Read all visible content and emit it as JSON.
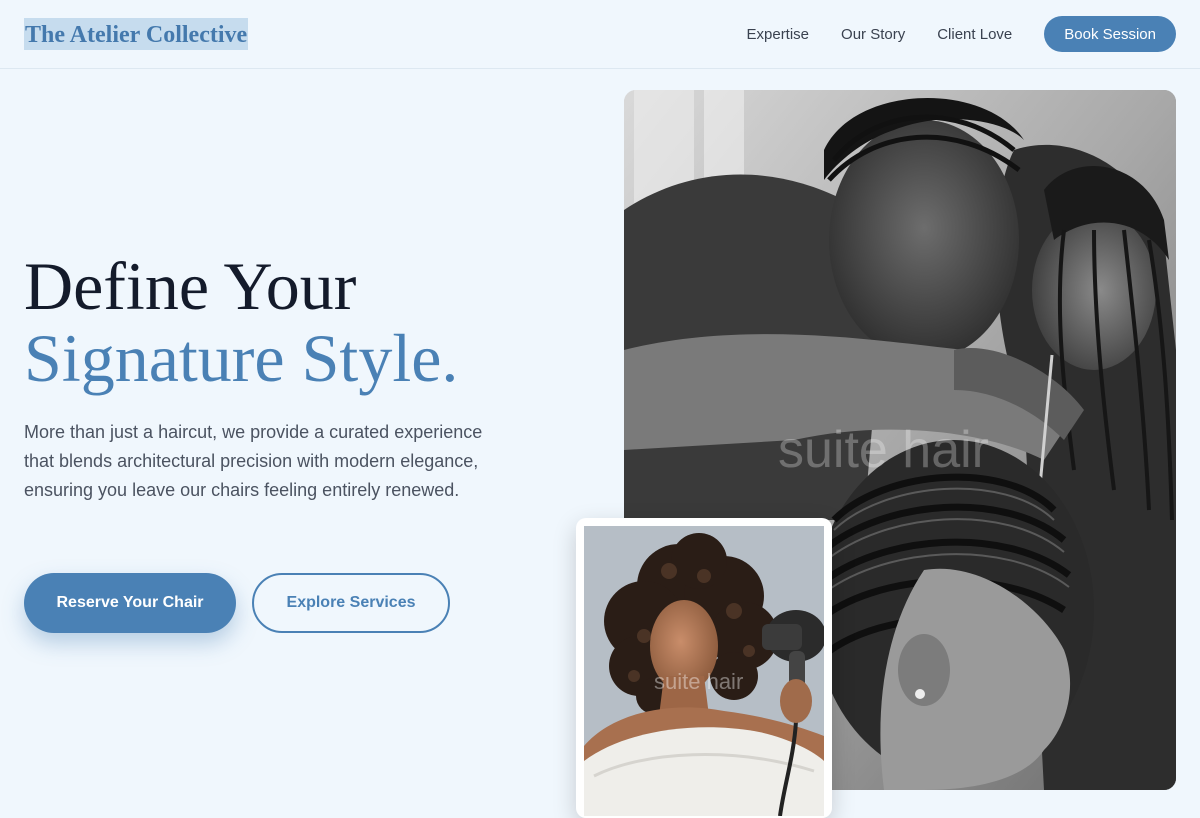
{
  "header": {
    "logo": "The Atelier Collective",
    "nav": [
      "Expertise",
      "Our Story",
      "Client Love"
    ],
    "cta": "Book Session"
  },
  "hero": {
    "title_line1": "Define Your",
    "title_line2": "Signature Style.",
    "description": "More than just a haircut, we provide a curated experience that blends architectural precision with modern elegance, ensuring you leave our chairs feeling entirely renewed.",
    "primary_button": "Reserve Your Chair",
    "secondary_button": "Explore Services"
  },
  "images": {
    "main_watermark": "suite hair",
    "inset_watermark": "suite hair",
    "main_alt_icon": "stylist-braiding-photo",
    "inset_alt_icon": "woman-curly-hair-dryer-photo"
  },
  "colors": {
    "accent": "#4a81b5",
    "background": "#f0f7fd",
    "heading": "#141b2b"
  }
}
